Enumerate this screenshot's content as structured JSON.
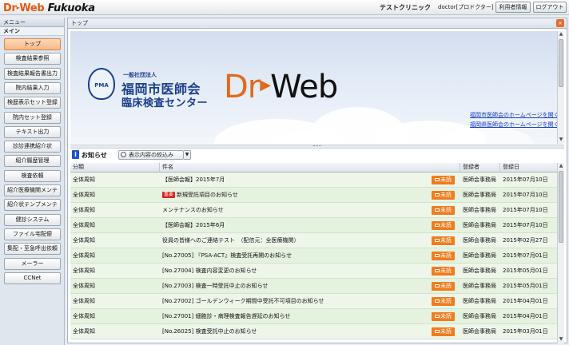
{
  "header": {
    "logo_dr": "Dr",
    "logo_arrow": "▸",
    "logo_web": "Web",
    "logo_fukuoka": "Fukuoka",
    "clinic": "テストクリニック",
    "user": "doctor[プロドクター]",
    "user_info_button": "利用者情報",
    "logout_button": "ログアウト"
  },
  "sidebar": {
    "heading": "メニュー",
    "subheading": "メイン",
    "items": [
      {
        "label": "トップ"
      },
      {
        "label": "検査結果参照"
      },
      {
        "label": "検査結果報告書出力"
      },
      {
        "label": "院内結果入力"
      },
      {
        "label": "検歴表示セット登録"
      },
      {
        "label": "院内セット登録"
      },
      {
        "label": "テキスト出力"
      },
      {
        "label": "診診連携紹介状"
      },
      {
        "label": "紹介履歴管理"
      },
      {
        "label": "検査依頼"
      },
      {
        "label": "紹介医療機関メンテ"
      },
      {
        "label": "紹介状テンプメンテ"
      },
      {
        "label": "健診システム"
      },
      {
        "label": "ファイル宅配便"
      },
      {
        "label": "集配・至急呼出依頼"
      },
      {
        "label": "メーラー"
      },
      {
        "label": "CCNet"
      }
    ]
  },
  "main": {
    "breadcrumb": "トップ",
    "close_glyph": "×"
  },
  "banner": {
    "emblem_text": "PMA",
    "org_type": "一般社団法人",
    "org_name1": "福岡市医師会",
    "org_name2": "臨床検査センター",
    "logo_dr": "Dr",
    "logo_arrow": "▶",
    "logo_web": "Web",
    "link1": "福岡市医師会のホームページを開く",
    "link2": "福岡県医師会のホームページを開く"
  },
  "notices": {
    "title": "お知らせ",
    "info_glyph": "i",
    "filter_label": "表示内容の絞込み",
    "columns": {
      "category": "分類",
      "name": "件名",
      "registrant": "登録者",
      "date": "登録日"
    },
    "rows": [
      {
        "category": "全体周知",
        "badge": "",
        "name": "【医師会報】2015年7月",
        "status": "未読",
        "registrant": "医師会事務局",
        "date": "2015年07月10日"
      },
      {
        "category": "全体周知",
        "badge": "重要",
        "name": "新規受託項目のお知らせ",
        "status": "未読",
        "registrant": "医師会事務局",
        "date": "2015年07月10日"
      },
      {
        "category": "全体周知",
        "badge": "",
        "name": "メンテナンスのお知らせ",
        "status": "未読",
        "registrant": "医師会事務局",
        "date": "2015年07月10日"
      },
      {
        "category": "全体周知",
        "badge": "",
        "name": "【医師会報】2015年6月",
        "status": "未読",
        "registrant": "医師会事務局",
        "date": "2015年07月10日"
      },
      {
        "category": "全体周知",
        "badge": "",
        "name": "役員の皆様へのご連絡テスト　（配信元：全医療機関）",
        "status": "未読",
        "registrant": "医師会事務局",
        "date": "2015年02月27日"
      },
      {
        "category": "全体周知",
        "badge": "",
        "name": "[No.27005] 『PSA-ACT』検査受託再開のお知らせ",
        "status": "未読",
        "registrant": "医師会事務局",
        "date": "2015年07月01日"
      },
      {
        "category": "全体周知",
        "badge": "",
        "name": "[No.27004] 検査内容変更のお知らせ",
        "status": "未読",
        "registrant": "医師会事務局",
        "date": "2015年05月01日"
      },
      {
        "category": "全体周知",
        "badge": "",
        "name": "[No.27003] 検査一時受託中止のお知らせ",
        "status": "未読",
        "registrant": "医師会事務局",
        "date": "2015年05月01日"
      },
      {
        "category": "全体周知",
        "badge": "",
        "name": "[No.27002] ゴールデンウィーク期間中受託不可項目のお知らせ",
        "status": "未読",
        "registrant": "医師会事務局",
        "date": "2015年04月01日"
      },
      {
        "category": "全体周知",
        "badge": "",
        "name": "[No.27001] 細胞診・病理検査報告遅延のお知らせ",
        "status": "未読",
        "registrant": "医師会事務局",
        "date": "2015年04月01日"
      },
      {
        "category": "全体周知",
        "badge": "",
        "name": "[No.26025] 検査受託中止のお知らせ",
        "status": "未読",
        "registrant": "医師会事務局",
        "date": "2015年03月01日"
      }
    ]
  }
}
